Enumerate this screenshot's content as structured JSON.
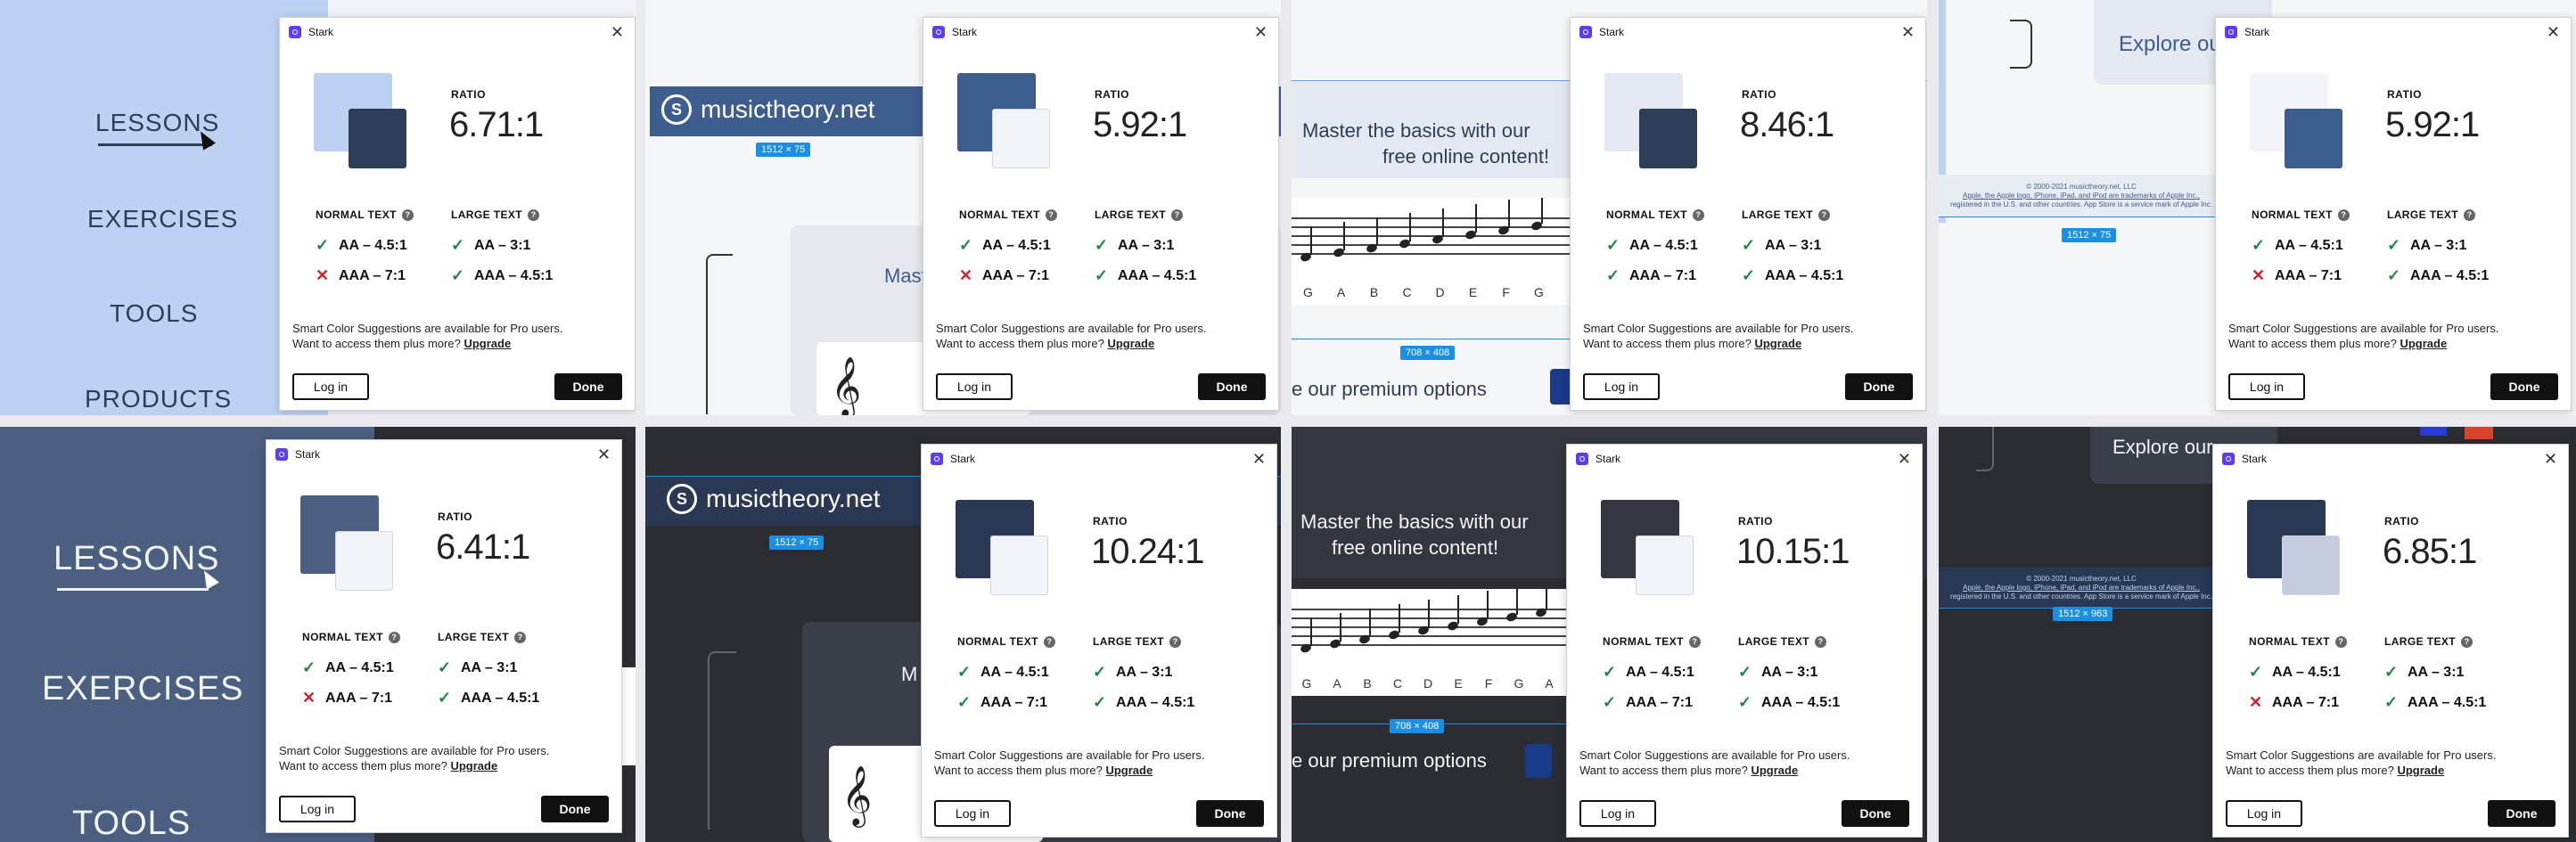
{
  "dialog": {
    "app_name": "Stark",
    "ratio_label": "RATIO",
    "normal_text_label": "NORMAL TEXT",
    "large_text_label": "LARGE TEXT",
    "aa_normal": "AA – 4.5:1",
    "aaa_normal": "AAA – 7:1",
    "aa_large": "AA – 3:1",
    "aaa_large": "AAA – 4.5:1",
    "tip_line1": "Smart Color Suggestions are available for Pro users.",
    "tip_line2": "Want to access them plus more?",
    "upgrade_link": "Upgrade",
    "login_button": "Log in",
    "done_button": "Done"
  },
  "site": {
    "logo_text": "musictheory.net",
    "nav": [
      "LESSONS",
      "EXERCISES",
      "TOOLS",
      "PRODUCTS"
    ],
    "hero_line1": "Master the basics with our",
    "hero_line2": "free online content!",
    "premium_text": "e our premium options",
    "explore_text": "Explore ou",
    "explore_text_dark": "Explore our",
    "hero_partial": "Mast",
    "hero_partial_dark": "M",
    "note_names": [
      "G",
      "A",
      "B",
      "C",
      "D",
      "E",
      "F",
      "G"
    ],
    "note_names_dark": [
      "G",
      "A",
      "B",
      "C",
      "D",
      "E",
      "F",
      "G",
      "A"
    ],
    "footer_line1": "© 2000-2021 musictheory.net, LLC",
    "footer_line2": "Apple, the Apple logo, iPhone, iPad, and iPod are trademarks of Apple Inc.,",
    "footer_line3": "registered in the U.S. and other countries. App Store is a service mark of Apple Inc."
  },
  "dims": {
    "a": "1512 × 75",
    "b": "708 × 408",
    "c": "1512 × 963"
  },
  "panels": [
    {
      "ratio": "6.71:1",
      "back": "#bdd2f3",
      "front": "#2e3e58",
      "aaa_normal_pass": false
    },
    {
      "ratio": "5.92:1",
      "back": "#3d5d8f",
      "front": "#f1f4f9",
      "aaa_normal_pass": false
    },
    {
      "ratio": "8.46:1",
      "back": "#e3e8f1",
      "front": "#2e3e58",
      "aaa_normal_pass": true
    },
    {
      "ratio": "5.92:1",
      "back": "#f1f4f9",
      "front": "#3d5d8f",
      "aaa_normal_pass": false
    },
    {
      "ratio": "6.41:1",
      "back": "#4b5f80",
      "front": "#f1f4f9",
      "aaa_normal_pass": false
    },
    {
      "ratio": "10.24:1",
      "back": "#2a3854",
      "front": "#f1f4f9",
      "aaa_normal_pass": true
    },
    {
      "ratio": "10.15:1",
      "back": "#34373f",
      "front": "#f1f4f9",
      "aaa_normal_pass": true
    },
    {
      "ratio": "6.85:1",
      "back": "#2a3854",
      "front": "#c3ccdc",
      "aaa_normal_pass": false
    }
  ],
  "colors": {
    "light_nav_bg": "#bdd2f3",
    "light_nav_text": "#2e3e58",
    "dark_nav_bg": "#4b5f80",
    "header_blue": "#3d5d8f",
    "header_dark": "#2a3854",
    "dark_bg": "#2b2d33",
    "dim_badge": "#1a8fe3",
    "pass_green": "#1b8a3c",
    "fail_red": "#d0202c"
  }
}
